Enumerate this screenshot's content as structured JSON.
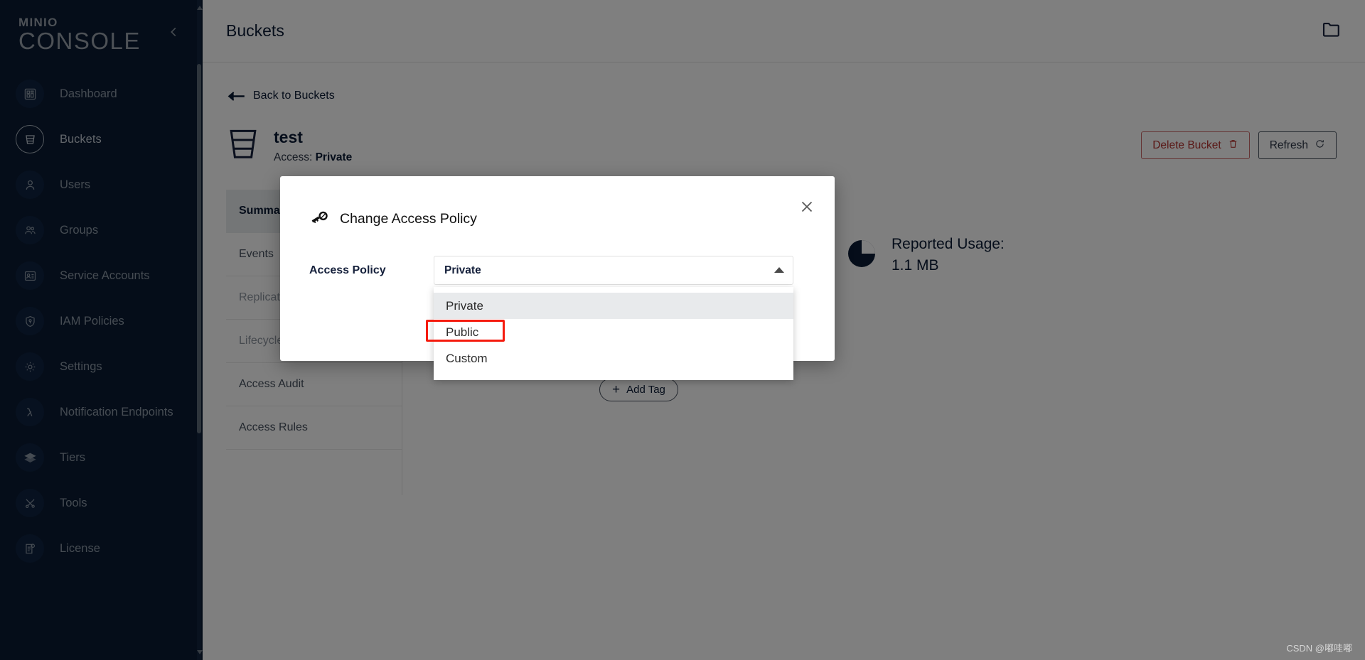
{
  "sidebar": {
    "brand_top": "MINIO",
    "brand_bottom": "CONSOLE",
    "collapse_icon": "chevron-left-icon",
    "items": [
      {
        "label": "Dashboard",
        "icon": "dashboard-icon",
        "active": false
      },
      {
        "label": "Buckets",
        "icon": "bucket-icon",
        "active": true
      },
      {
        "label": "Users",
        "icon": "user-icon",
        "active": false
      },
      {
        "label": "Groups",
        "icon": "groups-icon",
        "active": false
      },
      {
        "label": "Service Accounts",
        "icon": "id-card-icon",
        "active": false
      },
      {
        "label": "IAM Policies",
        "icon": "shield-icon",
        "active": false
      },
      {
        "label": "Settings",
        "icon": "gear-icon",
        "active": false
      },
      {
        "label": "Notification Endpoints",
        "icon": "lambda-icon",
        "active": false
      },
      {
        "label": "Tiers",
        "icon": "layers-icon",
        "active": false
      },
      {
        "label": "Tools",
        "icon": "tools-icon",
        "active": false
      },
      {
        "label": "License",
        "icon": "license-icon",
        "active": false
      }
    ]
  },
  "topbar": {
    "title": "Buckets",
    "folder_icon": "folder-icon"
  },
  "content": {
    "back_link": "Back to Buckets",
    "back_icon": "arrow-left-icon",
    "bucket_icon": "bucket-icon",
    "bucket_name": "test",
    "access_label": "Access:",
    "access_value": "Private",
    "delete_button": "Delete Bucket",
    "delete_icon": "trash-icon",
    "refresh_button": "Refresh",
    "refresh_icon": "refresh-icon",
    "tabs": [
      {
        "label": "Summary",
        "state": "active"
      },
      {
        "label": "Events",
        "state": "normal"
      },
      {
        "label": "Replication",
        "state": "disabled"
      },
      {
        "label": "Lifecycle",
        "state": "disabled"
      },
      {
        "label": "Access Audit",
        "state": "normal"
      },
      {
        "label": "Access Rules",
        "state": "normal"
      }
    ],
    "usage_icon": "pie-chart-icon",
    "usage_label": "Reported Usage:",
    "usage_value": "1.1 MB",
    "add_tag_label": "Add Tag",
    "add_tag_icon": "plus-icon"
  },
  "modal": {
    "icon": "key-icon",
    "title": "Change Access Policy",
    "close_icon": "close-icon",
    "field_label": "Access Policy",
    "selected_value": "Private",
    "caret_icon": "chevron-up-icon",
    "options": [
      {
        "label": "Private",
        "selected": true,
        "highlighted": false
      },
      {
        "label": "Public",
        "selected": false,
        "highlighted": true
      },
      {
        "label": "Custom",
        "selected": false,
        "highlighted": false
      }
    ]
  },
  "watermark": "CSDN @嘟哇嘟",
  "colors": {
    "sidebar_bg": "#0a1b33",
    "accent_dark": "#0b1b34",
    "danger": "#b5322f",
    "highlight_red": "#f51b0e",
    "option_selected_bg": "#e8eaec"
  }
}
